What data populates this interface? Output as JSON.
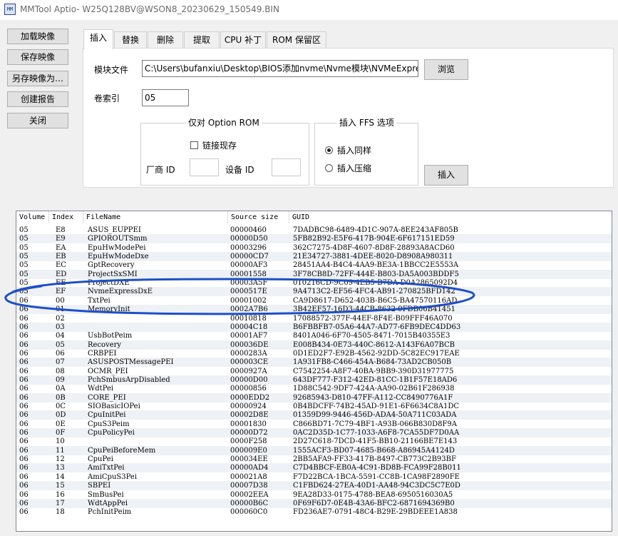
{
  "window": {
    "title": "MMTool Aptio- W25Q128BV@WSON8_20230629_150549.BIN",
    "icon_text": "MM"
  },
  "left_buttons": [
    "加载映像",
    "保存映像",
    "另存映像为…",
    "创建报告",
    "关闭"
  ],
  "tabs": [
    "插入",
    "替换",
    "删除",
    "提取",
    "CPU 补丁",
    "ROM 保留区"
  ],
  "insert": {
    "module_file_label": "模块文件",
    "module_file_value": "C:\\Users\\bufanxiu\\Desktop\\BIOS添加nvme\\Nvme模块\\NVMeExpre",
    "browse": "浏览",
    "volume_index_label": "卷索引",
    "volume_index_value": "05",
    "option_rom": {
      "title": "仅对 Option ROM",
      "link_existing": "链接现存",
      "vendor_id": "厂商 ID",
      "device_id": "设备 ID"
    },
    "ffs": {
      "title": "插入 FFS 选项",
      "insert_as_is": "插入同样",
      "insert_compressed": "插入压缩"
    },
    "insert_button": "插入"
  },
  "table": {
    "headers": [
      "Volume",
      "Index",
      "FileName",
      "Source size",
      "GUID"
    ],
    "rows": [
      [
        "05",
        "E8",
        "ASUS_EUPPEI",
        "00000460",
        "7DADBC98-6489-4D1C-907A-8EE243AF805B"
      ],
      [
        "05",
        "E9",
        "GPIOROUTSmm",
        "00000D50",
        "5FB82B92-E5F6-417B-904E-6F617151ED59"
      ],
      [
        "05",
        "EA",
        "EpuHwModePei",
        "00003296",
        "362C7275-4D8F-4607-8D8F-28893A8ACD60"
      ],
      [
        "05",
        "EB",
        "EpuHwModeDxe",
        "00000CD7",
        "21E34727-3881-4DEE-8020-D8908A980311"
      ],
      [
        "05",
        "EC",
        "GptRecovery",
        "00000AF3",
        "28451AA4-B4C4-4AA9-BE3A-1BBCC2E5553A"
      ],
      [
        "05",
        "ED",
        "ProjectSxSMI",
        "00001558",
        "3F78CB8D-72FF-444E-B803-DA5A003BDDF5"
      ],
      [
        "05",
        "EE",
        "ProjectDXE",
        "00003A5F",
        "010216CD-9C09-4EB5-B7DA-D0A2865092D4"
      ],
      [
        "05",
        "EF",
        "NvmeExpressDxE",
        "0000517E",
        "9A4713C2-EF56-4FC4-AB91-270825BFD142"
      ],
      [
        "06",
        "00",
        "TxtPei",
        "00001002",
        "CA9D8617-D652-403B-B6C5-BA47570116AD"
      ],
      [
        "06",
        "01",
        "MemoryInit",
        "0002A7B6",
        "3B42EF57-16D3-44CB-8632-9FDB06B41451"
      ],
      [
        "06",
        "02",
        "",
        "00010818",
        "17088572-377F-44EF-8F4E-B09FFF46A070"
      ],
      [
        "06",
        "03",
        "",
        "00004C18",
        "B6FBBFB7-05A6-44A7-AD77-6FB9DEC4DD63"
      ],
      [
        "06",
        "04",
        "UsbBotPeim",
        "00001AF7",
        "8401A046-6F70-4505-8471-7015B40355E3"
      ],
      [
        "06",
        "05",
        "Recovery",
        "000036DE",
        "E008B434-0E73-440C-8612-A143F6A07BCB"
      ],
      [
        "06",
        "06",
        "CRBPEI",
        "0000283A",
        "0D1ED2F7-E92B-4562-92DD-5C82EC917EAE"
      ],
      [
        "06",
        "07",
        "ASUSPOSTMessagePEI",
        "000003CE",
        "1A931FB8-C466-454A-B684-73AD2CB050B"
      ],
      [
        "06",
        "08",
        "OCMR_PEI",
        "0000927A",
        "C7542254-A8F7-40BA-9BB9-390D31977775"
      ],
      [
        "06",
        "09",
        "PchSmbusArpDisabled",
        "00000D00",
        "643DF777-F312-42ED-81CC-1B1F57E18AD6"
      ],
      [
        "06",
        "0A",
        "WdtPei",
        "00000856",
        "1D88C542-9DF7-424A-AA90-02B61F286938"
      ],
      [
        "06",
        "0B",
        "CORE_PEI",
        "0000EDD2",
        "92685943-D810-47FF-A112-CC8490776A1F"
      ],
      [
        "06",
        "0C",
        "SIOBasicIOPei",
        "00000924",
        "0B4BDCFF-74B2-45AD-91E1-6F6634C8A1DC"
      ],
      [
        "06",
        "0D",
        "CpuInitPei",
        "00002D8E",
        "01359D99-9446-456D-ADA4-50A711C03ADA"
      ],
      [
        "06",
        "0E",
        "CpuS3Peim",
        "00001830",
        "C866BD71-7C79-4BF1-A93B-066B830D8F9A"
      ],
      [
        "06",
        "0F",
        "CpuPolicyPei",
        "00000D72",
        "0AC2D35D-1C77-1033-A6F8-7CA55DF7D0AA"
      ],
      [
        "06",
        "10",
        "",
        "0000F258",
        "2D27C618-7DCD-41F5-BB10-21166BE7E143"
      ],
      [
        "06",
        "11",
        "CpuPeiBeforeMem",
        "000009E0",
        "1555ACF3-BD07-4685-B668-A86945A4124D"
      ],
      [
        "06",
        "12",
        "CpuPei",
        "000034EE",
        "2BB5AFA9-FF33-417B-8497-CB773C2B93BF"
      ],
      [
        "06",
        "13",
        "AmiTxtPei",
        "00000AD4",
        "C7D4BBCF-EB0A-4C91-BD8B-FCA99F28B011"
      ],
      [
        "06",
        "14",
        "AmiCpuS3Pei",
        "000021A8",
        "F7D22BCA-1BCA-5591-CC8B-1CA98F2890FE"
      ],
      [
        "06",
        "15",
        "SBPEI",
        "00007D38",
        "C1FBD624-27EA-40D1-AA48-94C3DC5C7E0D"
      ],
      [
        "06",
        "16",
        "SmBusPei",
        "00002EEA",
        "9EA28D33-0175-4788-BEA8-6950516030A5"
      ],
      [
        "06",
        "17",
        "WdtAppPei",
        "00000B6C",
        "0F69F6D7-0E4B-43A6-BFC2-6871694369B0"
      ],
      [
        "06",
        "18",
        "PchInitPeim",
        "000060C0",
        "FD236AE7-0791-48C4-B29E-29BDEEE1A838"
      ]
    ]
  },
  "colors": {
    "annotation": "#1d4fc9",
    "stripe": "#eef1f5"
  }
}
